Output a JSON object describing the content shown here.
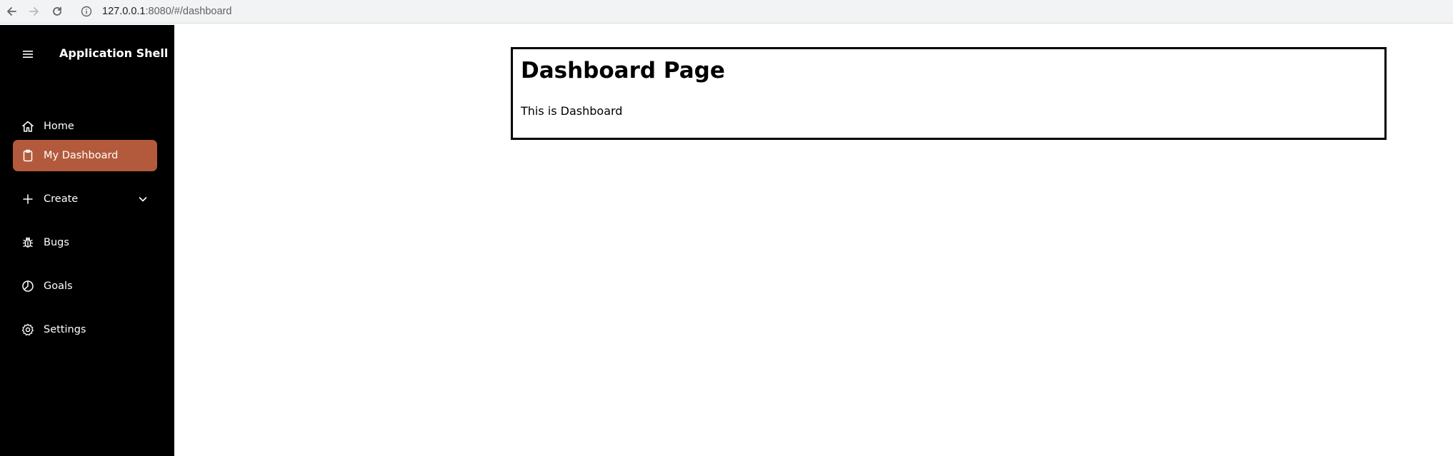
{
  "browser": {
    "url_host": "127.0.0.1",
    "url_path": ":8080/#/dashboard"
  },
  "sidebar": {
    "app_title": "Application Shell",
    "items": [
      {
        "label": "Home",
        "icon": "home-icon",
        "active": false
      },
      {
        "label": "My Dashboard",
        "icon": "clipboard-icon",
        "active": true
      },
      {
        "label": "Create",
        "icon": "plus-icon",
        "active": false,
        "expandable": true
      },
      {
        "label": "Bugs",
        "icon": "bug-icon",
        "active": false
      },
      {
        "label": "Goals",
        "icon": "pie-chart-icon",
        "active": false
      },
      {
        "label": "Settings",
        "icon": "gear-icon",
        "active": false
      }
    ]
  },
  "main": {
    "title": "Dashboard Page",
    "body": "This is Dashboard"
  },
  "colors": {
    "sidebar_bg": "#000000",
    "active_item_bg": "#b35a3c",
    "panel_border": "#000000"
  }
}
